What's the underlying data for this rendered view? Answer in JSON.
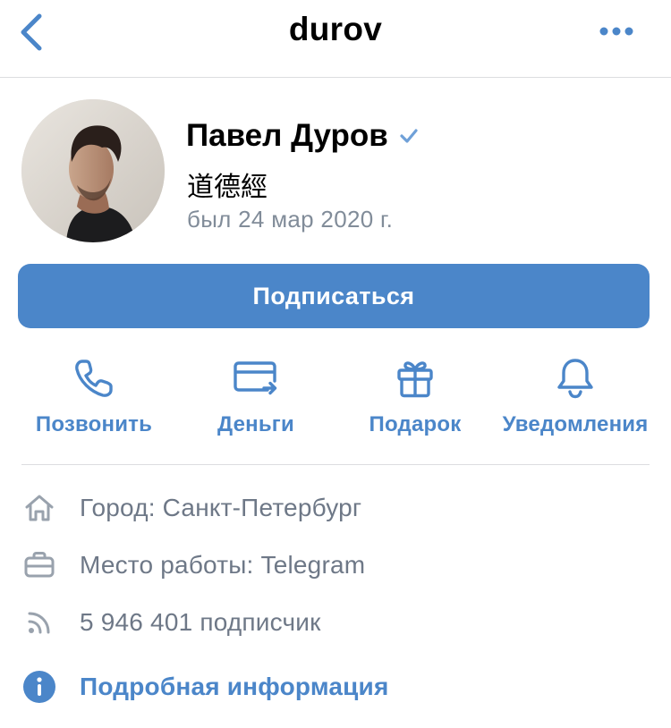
{
  "nav": {
    "title": "durov",
    "back_icon": "chevron-left-icon",
    "more_icon": "more-horizontal-icon"
  },
  "profile": {
    "name": "Павел Дуров",
    "status": "道德經",
    "last_seen": "был 24 мар 2020 г.",
    "verified": true
  },
  "subscribe_button": {
    "label": "Подписаться"
  },
  "actions": [
    {
      "label": "Позвонить",
      "icon": "phone-icon"
    },
    {
      "label": "Деньги",
      "icon": "money-transfer-icon"
    },
    {
      "label": "Подарок",
      "icon": "gift-icon"
    },
    {
      "label": "Уведомления",
      "icon": "bell-icon"
    }
  ],
  "info": [
    {
      "text": "Город: Санкт-Петербург",
      "icon": "home-icon"
    },
    {
      "text": "Место работы: Telegram",
      "icon": "briefcase-icon"
    },
    {
      "text": "5 946 401 подписчик",
      "icon": "followers-icon"
    },
    {
      "text": "Подробная информация",
      "icon": "info-icon"
    }
  ],
  "colors": {
    "accent": "#4b86c9",
    "secondary_text": "#818c99",
    "icon_gray": "#99a2ad",
    "divider": "#dcdde0"
  }
}
